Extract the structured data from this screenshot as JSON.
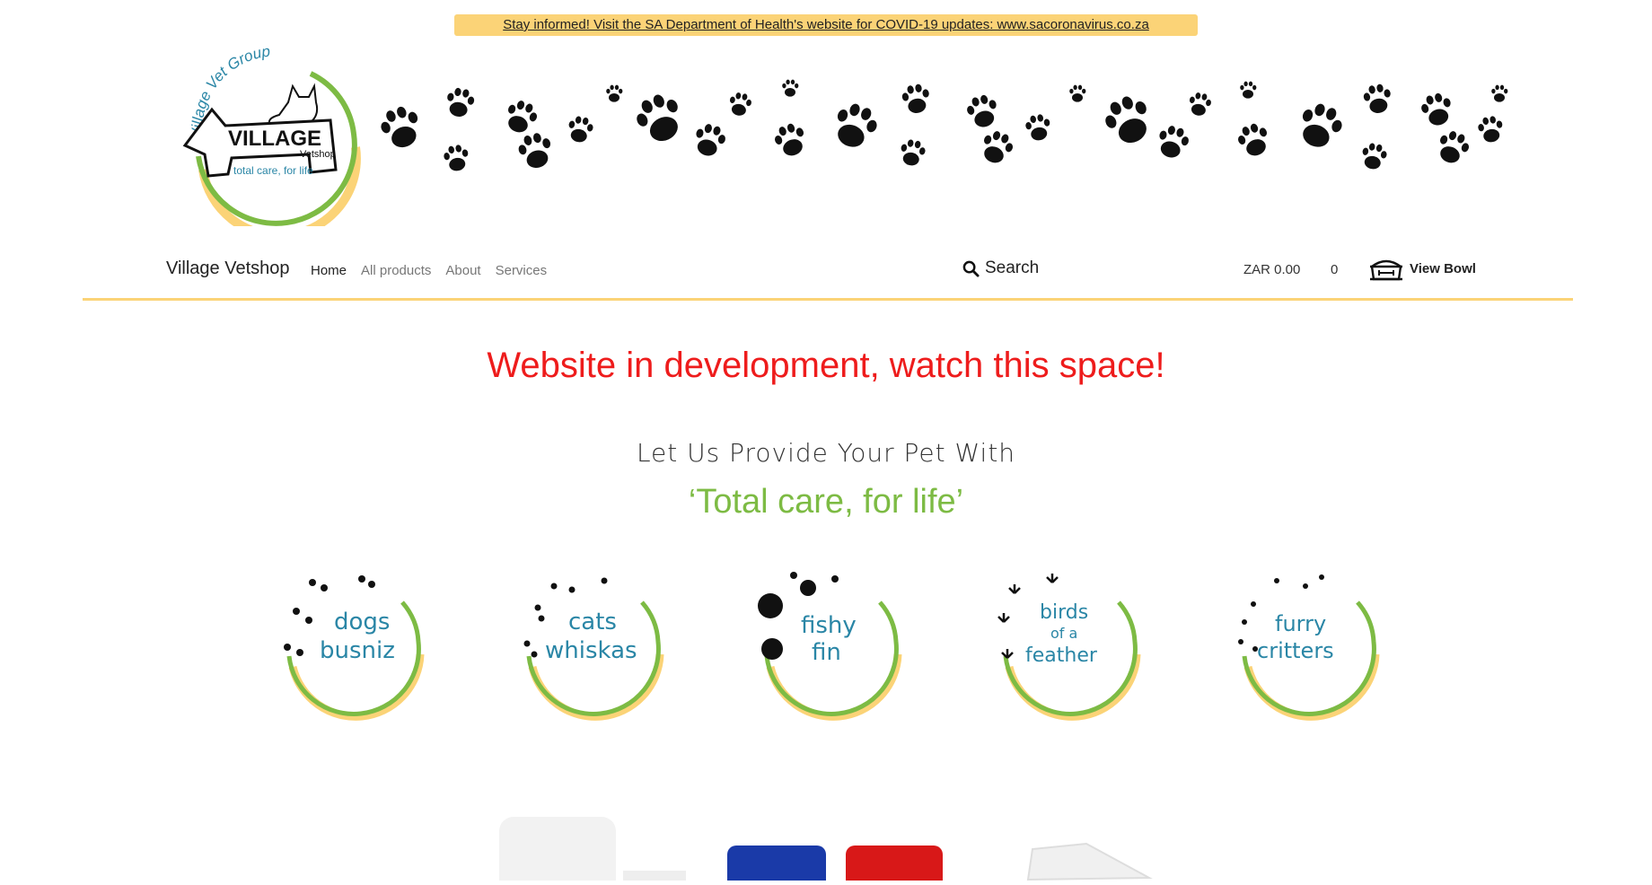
{
  "banner": {
    "text": "Stay informed! Visit the SA Department of Health's website for COVID-19 updates: www.sacoronavirus.co.za"
  },
  "logo": {
    "arc_text": "Village Vet Group",
    "name": "VILLAGE",
    "sub": "Vetshop",
    "slogan": "total care, for life"
  },
  "nav": {
    "brand": "Village Vetshop",
    "links": [
      "Home",
      "All products",
      "About",
      "Services"
    ],
    "search_label": "Search",
    "cart_total": "ZAR 0.00",
    "cart_count": "0",
    "view_bowl": "View Bowl"
  },
  "main": {
    "headline": "Website in development, watch this space!",
    "subhead": "Let Us Provide Your Pet With",
    "tagline": "‘Total care, for life’"
  },
  "categories": [
    {
      "line1": "dogs",
      "line2": "busniz",
      "icon": "paw-icon"
    },
    {
      "line1": "cats",
      "line2": "whiskas",
      "icon": "paw-icon"
    },
    {
      "line1": "fishy",
      "line2": "fin",
      "icon": "bubble-icon"
    },
    {
      "line1": "birds",
      "line2": "of a",
      "line3": "feather",
      "icon": "bird-track-icon"
    },
    {
      "line1": "furry",
      "line2": "critters",
      "icon": "small-paw-icon"
    }
  ],
  "colors": {
    "accent_yellow": "#fbd377",
    "headline_red": "#ee1c1c",
    "brand_green": "#7dbb44",
    "category_blue": "#2a86a6"
  }
}
